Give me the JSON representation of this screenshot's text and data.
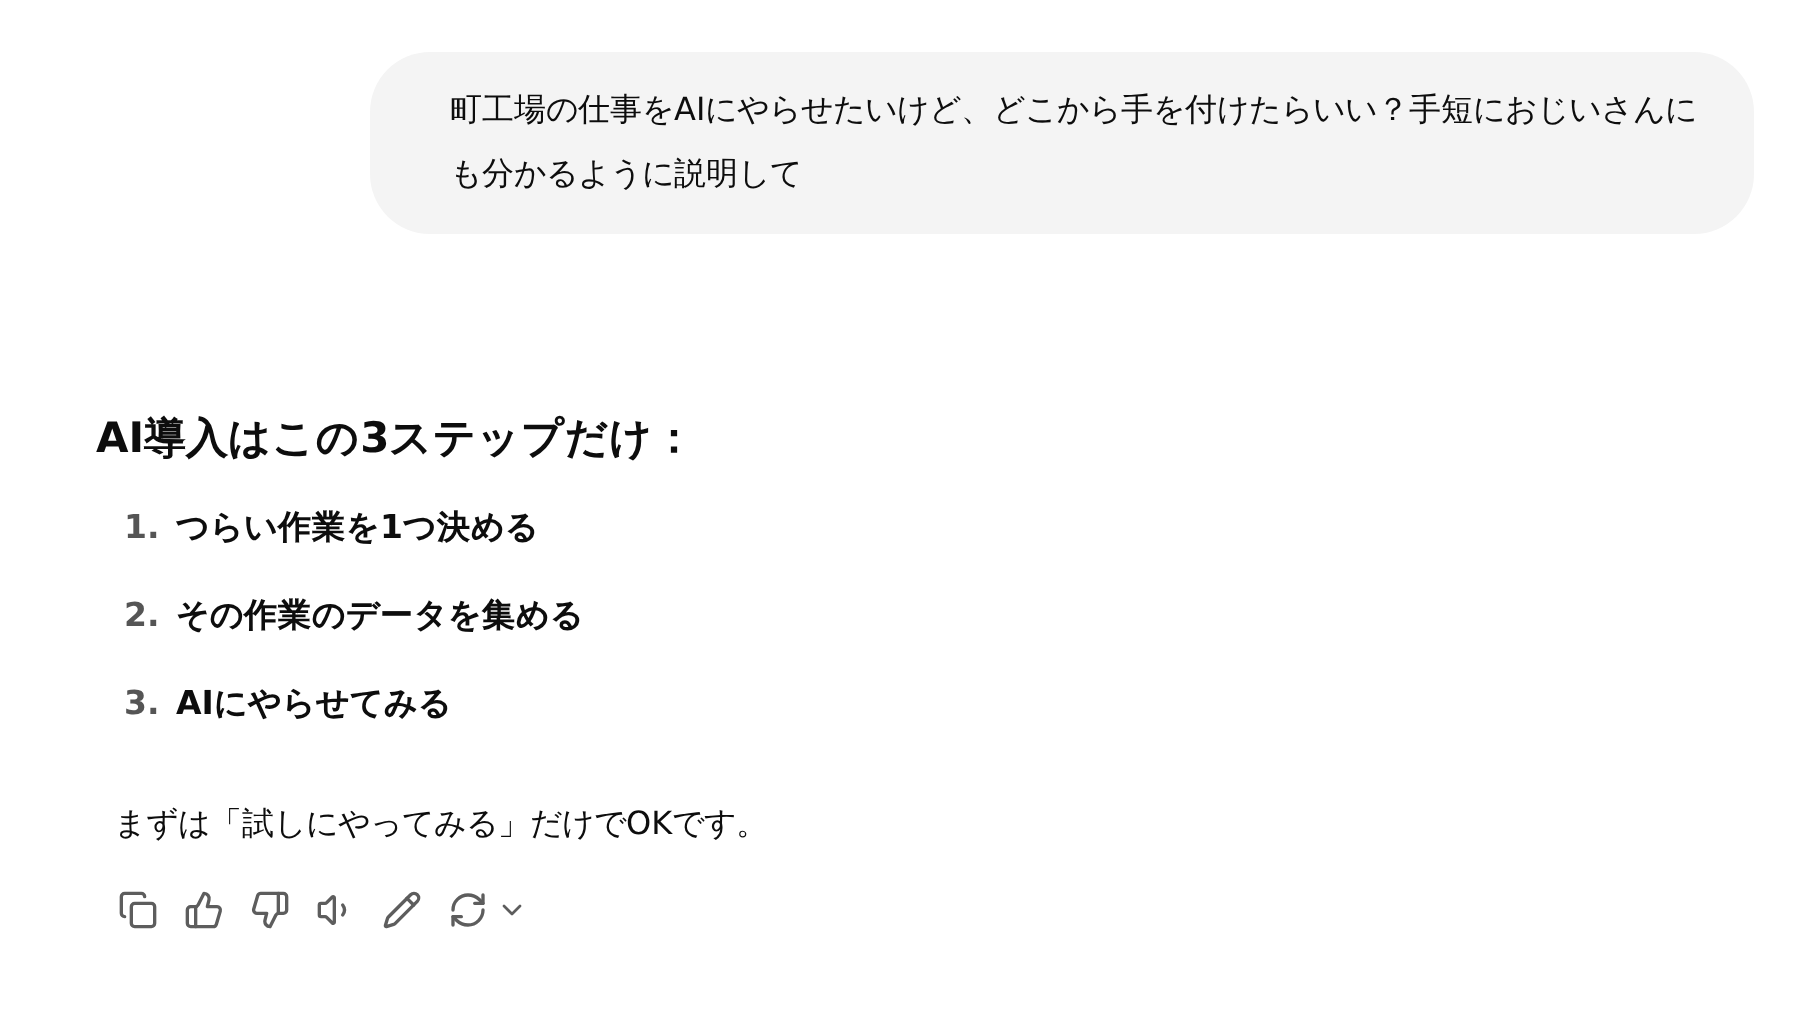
{
  "user_message": "町工場の仕事をAIにやらせたいけど、どこから手を付けたらいい？手短におじいさんにも分かるように説明して",
  "answer": {
    "heading": "AI導入はこの3ステップだけ：",
    "steps": [
      {
        "number": "1.",
        "text": "つらい作業を1つ決める"
      },
      {
        "number": "2.",
        "text": "その作業のデータを集める"
      },
      {
        "number": "3.",
        "text": "AIにやらせてみる"
      }
    ],
    "note": "まずは「試しにやってみる」だけでOKです。"
  },
  "actions": [
    {
      "kind": "copy"
    },
    {
      "kind": "like"
    },
    {
      "kind": "dislike"
    },
    {
      "kind": "read"
    },
    {
      "kind": "edit"
    },
    {
      "kind": "regenerate"
    }
  ]
}
